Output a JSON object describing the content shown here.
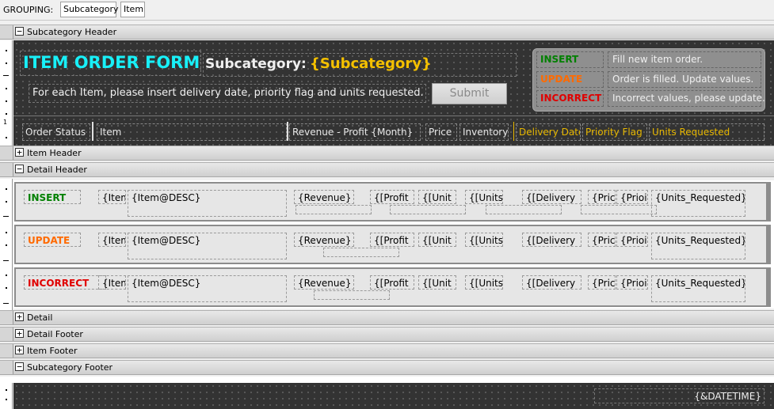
{
  "grouping": {
    "label": "GROUPING:",
    "chips": [
      "Subcategory",
      "Item"
    ]
  },
  "bands": {
    "subcategory_header": "Subcategory Header",
    "item_header": "Item Header",
    "detail_header": "Detail Header",
    "detail": "Detail",
    "detail_footer": "Detail Footer",
    "item_footer": "Item Footer",
    "subcategory_footer": "Subcategory Footer"
  },
  "form": {
    "title": "ITEM ORDER FORM",
    "subcategory_label": "Subcategory:",
    "subcategory_value": "{Subcategory}",
    "instructions": "For each Item, please insert delivery date, priority flag and units requested.",
    "submit_label": "Submit"
  },
  "legend": [
    {
      "key": "INSERT",
      "desc": "Fill new item order.",
      "color": "#008000"
    },
    {
      "key": "UPDATE",
      "desc": "Order is filled. Update values.",
      "color": "#ff6a00"
    },
    {
      "key": "INCORRECT",
      "desc": "Incorrect values, please update.",
      "color": "#e00000"
    }
  ],
  "columns": [
    "Order Status",
    "Item",
    "Revenue - Profit {Month}",
    "Price",
    "Inventory",
    "Delivery Date",
    "Priority Flag",
    "Units Requested"
  ],
  "detail_rows": [
    {
      "status": "INSERT",
      "color": "#008000"
    },
    {
      "status": "UPDATE",
      "color": "#ff6a00"
    },
    {
      "status": "INCORRECT",
      "color": "#e00000"
    }
  ],
  "row_fields": {
    "item_short": "{Item",
    "item_desc": "{Item@DESC}",
    "revenue": "{Revenue}",
    "profit": "{[Profit",
    "unit": "{[Unit",
    "units": "{[Units",
    "delivery": "{[Delivery",
    "prio": "{Pric",
    "prio2": "{Prioi",
    "units_requested": "{Units_Requested}"
  },
  "footer": {
    "datetime": "{&DATETIME}"
  },
  "ruler": {
    "mark": "1"
  }
}
